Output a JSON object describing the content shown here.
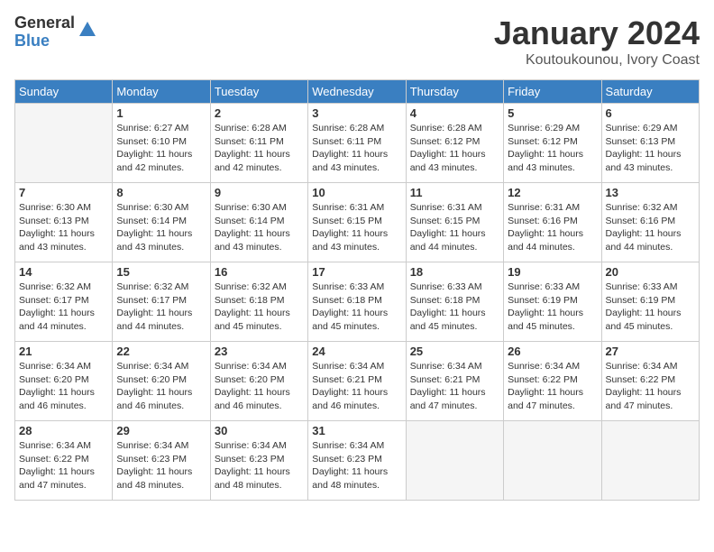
{
  "header": {
    "logo_general": "General",
    "logo_blue": "Blue",
    "month_title": "January 2024",
    "location": "Koutoukounou, Ivory Coast"
  },
  "weekdays": [
    "Sunday",
    "Monday",
    "Tuesday",
    "Wednesday",
    "Thursday",
    "Friday",
    "Saturday"
  ],
  "weeks": [
    [
      {
        "day": "",
        "info": ""
      },
      {
        "day": "1",
        "info": "Sunrise: 6:27 AM\nSunset: 6:10 PM\nDaylight: 11 hours\nand 42 minutes."
      },
      {
        "day": "2",
        "info": "Sunrise: 6:28 AM\nSunset: 6:11 PM\nDaylight: 11 hours\nand 42 minutes."
      },
      {
        "day": "3",
        "info": "Sunrise: 6:28 AM\nSunset: 6:11 PM\nDaylight: 11 hours\nand 43 minutes."
      },
      {
        "day": "4",
        "info": "Sunrise: 6:28 AM\nSunset: 6:12 PM\nDaylight: 11 hours\nand 43 minutes."
      },
      {
        "day": "5",
        "info": "Sunrise: 6:29 AM\nSunset: 6:12 PM\nDaylight: 11 hours\nand 43 minutes."
      },
      {
        "day": "6",
        "info": "Sunrise: 6:29 AM\nSunset: 6:13 PM\nDaylight: 11 hours\nand 43 minutes."
      }
    ],
    [
      {
        "day": "7",
        "info": "Sunrise: 6:30 AM\nSunset: 6:13 PM\nDaylight: 11 hours\nand 43 minutes."
      },
      {
        "day": "8",
        "info": "Sunrise: 6:30 AM\nSunset: 6:14 PM\nDaylight: 11 hours\nand 43 minutes."
      },
      {
        "day": "9",
        "info": "Sunrise: 6:30 AM\nSunset: 6:14 PM\nDaylight: 11 hours\nand 43 minutes."
      },
      {
        "day": "10",
        "info": "Sunrise: 6:31 AM\nSunset: 6:15 PM\nDaylight: 11 hours\nand 43 minutes."
      },
      {
        "day": "11",
        "info": "Sunrise: 6:31 AM\nSunset: 6:15 PM\nDaylight: 11 hours\nand 44 minutes."
      },
      {
        "day": "12",
        "info": "Sunrise: 6:31 AM\nSunset: 6:16 PM\nDaylight: 11 hours\nand 44 minutes."
      },
      {
        "day": "13",
        "info": "Sunrise: 6:32 AM\nSunset: 6:16 PM\nDaylight: 11 hours\nand 44 minutes."
      }
    ],
    [
      {
        "day": "14",
        "info": "Sunrise: 6:32 AM\nSunset: 6:17 PM\nDaylight: 11 hours\nand 44 minutes."
      },
      {
        "day": "15",
        "info": "Sunrise: 6:32 AM\nSunset: 6:17 PM\nDaylight: 11 hours\nand 44 minutes."
      },
      {
        "day": "16",
        "info": "Sunrise: 6:32 AM\nSunset: 6:18 PM\nDaylight: 11 hours\nand 45 minutes."
      },
      {
        "day": "17",
        "info": "Sunrise: 6:33 AM\nSunset: 6:18 PM\nDaylight: 11 hours\nand 45 minutes."
      },
      {
        "day": "18",
        "info": "Sunrise: 6:33 AM\nSunset: 6:18 PM\nDaylight: 11 hours\nand 45 minutes."
      },
      {
        "day": "19",
        "info": "Sunrise: 6:33 AM\nSunset: 6:19 PM\nDaylight: 11 hours\nand 45 minutes."
      },
      {
        "day": "20",
        "info": "Sunrise: 6:33 AM\nSunset: 6:19 PM\nDaylight: 11 hours\nand 45 minutes."
      }
    ],
    [
      {
        "day": "21",
        "info": "Sunrise: 6:34 AM\nSunset: 6:20 PM\nDaylight: 11 hours\nand 46 minutes."
      },
      {
        "day": "22",
        "info": "Sunrise: 6:34 AM\nSunset: 6:20 PM\nDaylight: 11 hours\nand 46 minutes."
      },
      {
        "day": "23",
        "info": "Sunrise: 6:34 AM\nSunset: 6:20 PM\nDaylight: 11 hours\nand 46 minutes."
      },
      {
        "day": "24",
        "info": "Sunrise: 6:34 AM\nSunset: 6:21 PM\nDaylight: 11 hours\nand 46 minutes."
      },
      {
        "day": "25",
        "info": "Sunrise: 6:34 AM\nSunset: 6:21 PM\nDaylight: 11 hours\nand 47 minutes."
      },
      {
        "day": "26",
        "info": "Sunrise: 6:34 AM\nSunset: 6:22 PM\nDaylight: 11 hours\nand 47 minutes."
      },
      {
        "day": "27",
        "info": "Sunrise: 6:34 AM\nSunset: 6:22 PM\nDaylight: 11 hours\nand 47 minutes."
      }
    ],
    [
      {
        "day": "28",
        "info": "Sunrise: 6:34 AM\nSunset: 6:22 PM\nDaylight: 11 hours\nand 47 minutes."
      },
      {
        "day": "29",
        "info": "Sunrise: 6:34 AM\nSunset: 6:23 PM\nDaylight: 11 hours\nand 48 minutes."
      },
      {
        "day": "30",
        "info": "Sunrise: 6:34 AM\nSunset: 6:23 PM\nDaylight: 11 hours\nand 48 minutes."
      },
      {
        "day": "31",
        "info": "Sunrise: 6:34 AM\nSunset: 6:23 PM\nDaylight: 11 hours\nand 48 minutes."
      },
      {
        "day": "",
        "info": ""
      },
      {
        "day": "",
        "info": ""
      },
      {
        "day": "",
        "info": ""
      }
    ]
  ]
}
